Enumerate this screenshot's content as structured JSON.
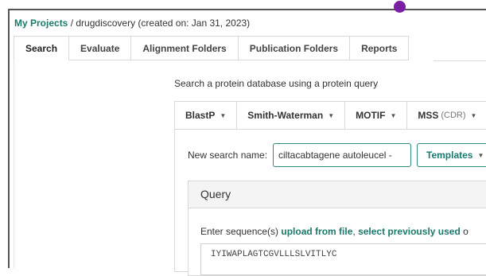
{
  "breadcrumb": {
    "root": "My Projects",
    "separator": " / ",
    "current": "drugdiscovery (created on: Jan 31, 2023)"
  },
  "tabs": [
    {
      "label": "Search",
      "active": true
    },
    {
      "label": "Evaluate"
    },
    {
      "label": "Alignment Folders"
    },
    {
      "label": "Publication Folders"
    },
    {
      "label": "Reports"
    }
  ],
  "search": {
    "subtitle": "Search a protein database using a protein query",
    "algorithms": [
      {
        "label": "BlastP"
      },
      {
        "label": "Smith-Waterman"
      },
      {
        "label": "MOTIF"
      },
      {
        "label": "MSS",
        "sub": "(CDR)"
      }
    ],
    "name_label": "New search name:",
    "name_value": "ciltacabtagene autoleucel -",
    "templates_label": "Templates",
    "query": {
      "title": "Query",
      "enter_text": "Enter sequence(s) ",
      "upload_link": "upload from file",
      "comma": ", ",
      "previous_link": "select previously used",
      "trailing": " o",
      "sequence": "IYIWAPLAGTCGVLLLSLVITLYC"
    }
  },
  "colors": {
    "accent": "#1a7a6c",
    "input_border": "#2a8a7c",
    "notification_dot": "#7a1fa2"
  }
}
